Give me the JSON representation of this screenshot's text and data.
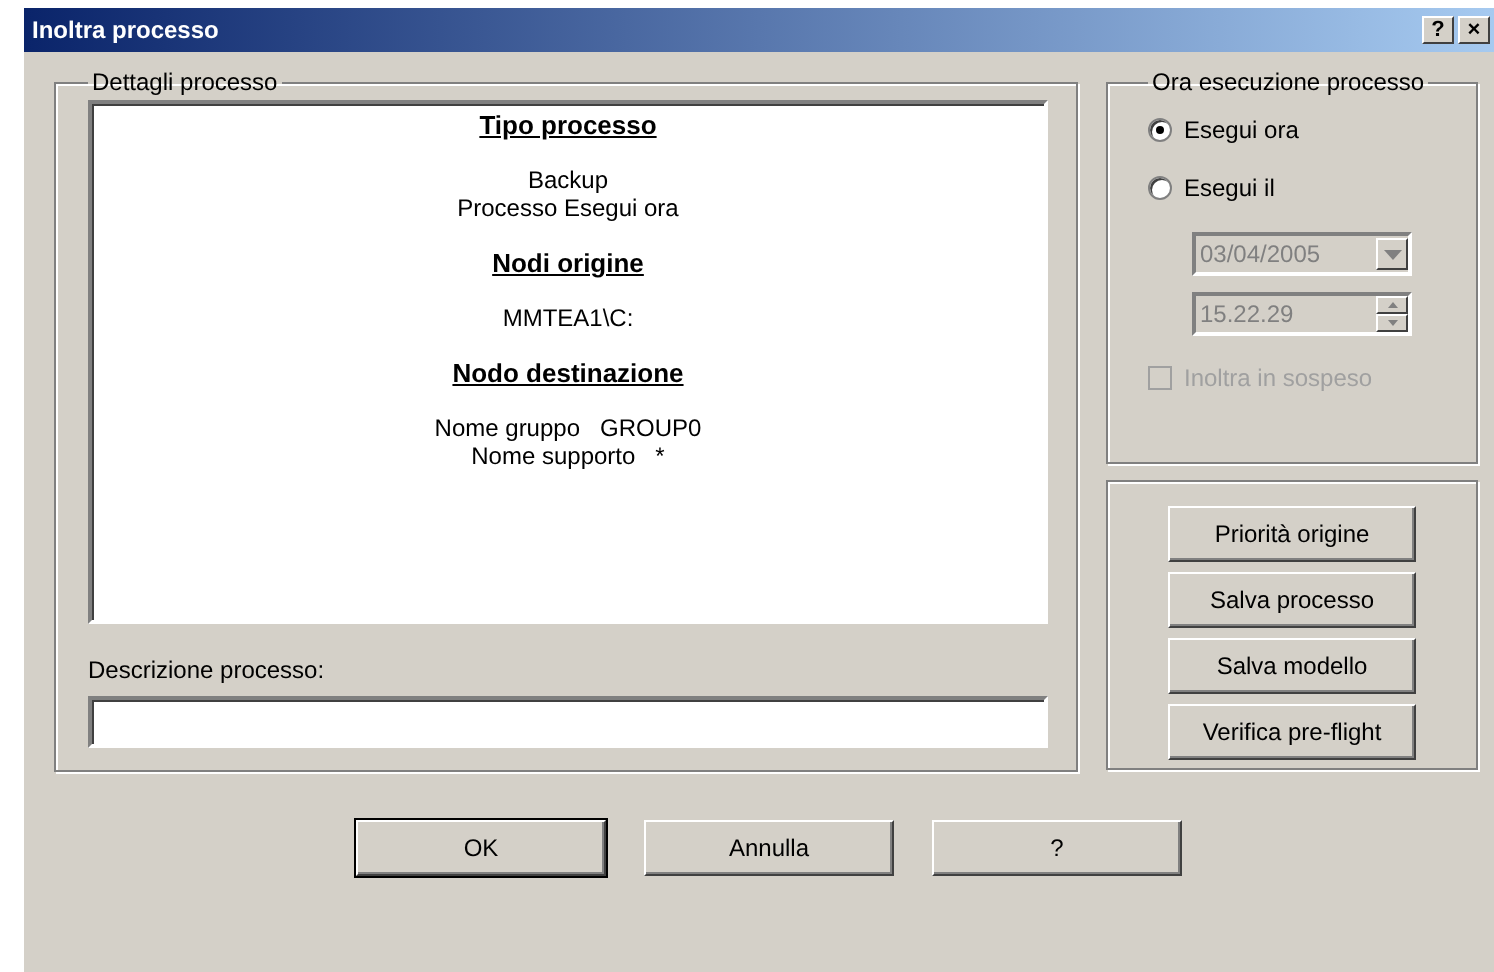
{
  "window": {
    "title": "Inoltra processo",
    "title_buttons": [
      "?",
      "×"
    ]
  },
  "details": {
    "label": "Dettagli processo",
    "lines": [
      {
        "kind": "heading",
        "text": "Tipo processo"
      },
      {
        "kind": "text",
        "text": "Backup"
      },
      {
        "kind": "text",
        "text": "Processo Esegui ora"
      },
      {
        "kind": "heading",
        "text": "Nodi origine"
      },
      {
        "kind": "text",
        "text": "MMTEA1\\C:"
      },
      {
        "kind": "heading",
        "text": "Nodo destinazione"
      },
      {
        "kind": "text",
        "text": "Nome gruppo   GROUP0"
      },
      {
        "kind": "text",
        "text": "Nome supporto   *"
      }
    ],
    "description_label": "Descrizione processo:"
  },
  "schedule": {
    "label": "Ora esecuzione processo",
    "options": [
      {
        "label": "Esegui ora",
        "selected": true
      },
      {
        "label": "Esegui il",
        "selected": false
      }
    ],
    "date": {
      "value": "03/04/2005",
      "disabled": true
    },
    "time": {
      "value": "15.22.29",
      "disabled": true
    },
    "hold": {
      "label": "Inoltra in sospeso",
      "checked": false,
      "disabled": true
    }
  },
  "actions": [
    "Priorità origine",
    "Salva processo",
    "Salva modello",
    "Verifica pre-flight"
  ],
  "buttons": [
    {
      "label": "OK",
      "default": true
    },
    {
      "label": "Annulla",
      "default": false
    },
    {
      "label": "?",
      "default": false
    }
  ]
}
